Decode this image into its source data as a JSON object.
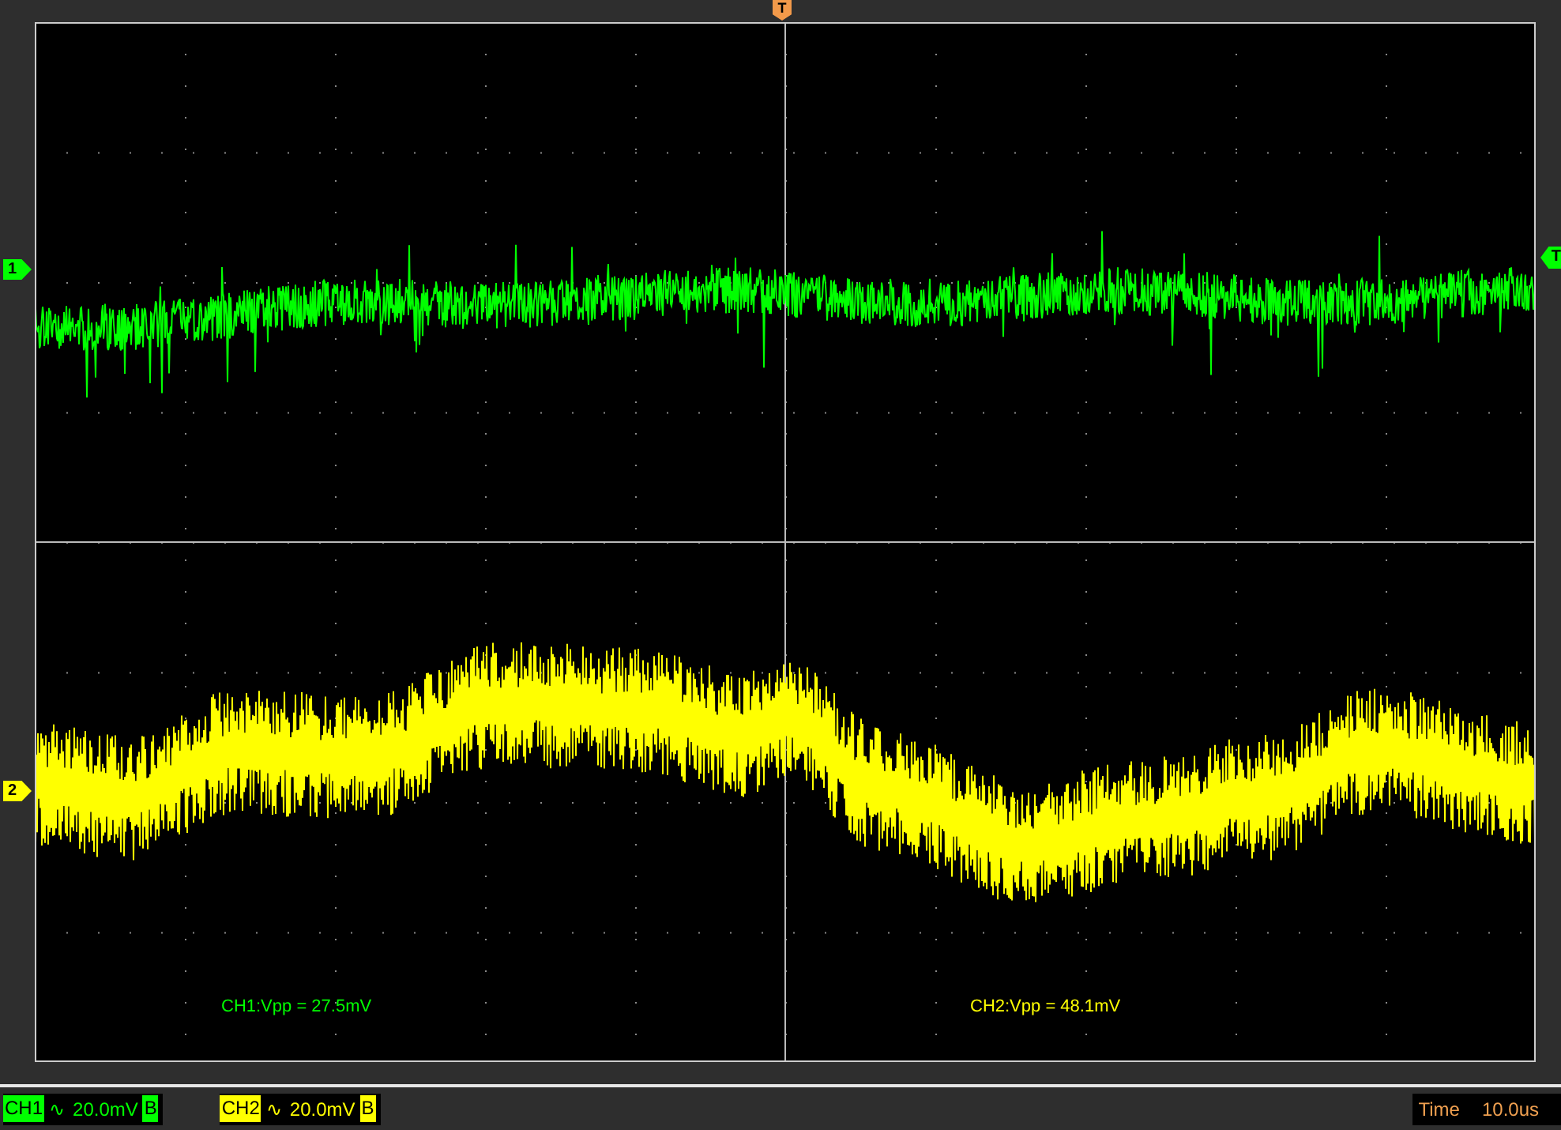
{
  "trigger_marker": {
    "label": "T"
  },
  "trigger_level_marker": {
    "label": "T",
    "color": "#00ff00"
  },
  "channels": [
    {
      "marker": "1",
      "color": "#00ff00"
    },
    {
      "marker": "2",
      "color": "#ffff00"
    }
  ],
  "measurements": [
    {
      "text": "CH1:Vpp = 27.5mV",
      "color": "#00ff00"
    },
    {
      "text": "CH2:Vpp = 48.1mV",
      "color": "#ffff00"
    }
  ],
  "status_bar": {
    "channels": [
      {
        "name": "CH1",
        "coupling": "∿",
        "scale": "20.0mV",
        "bandwidth": "B",
        "color": "#00ff00"
      },
      {
        "name": "CH2",
        "coupling": "∿",
        "scale": "20.0mV",
        "bandwidth": "B",
        "color": "#ffff00"
      }
    ],
    "time_label": "Time",
    "time_value": "10.0us"
  }
}
